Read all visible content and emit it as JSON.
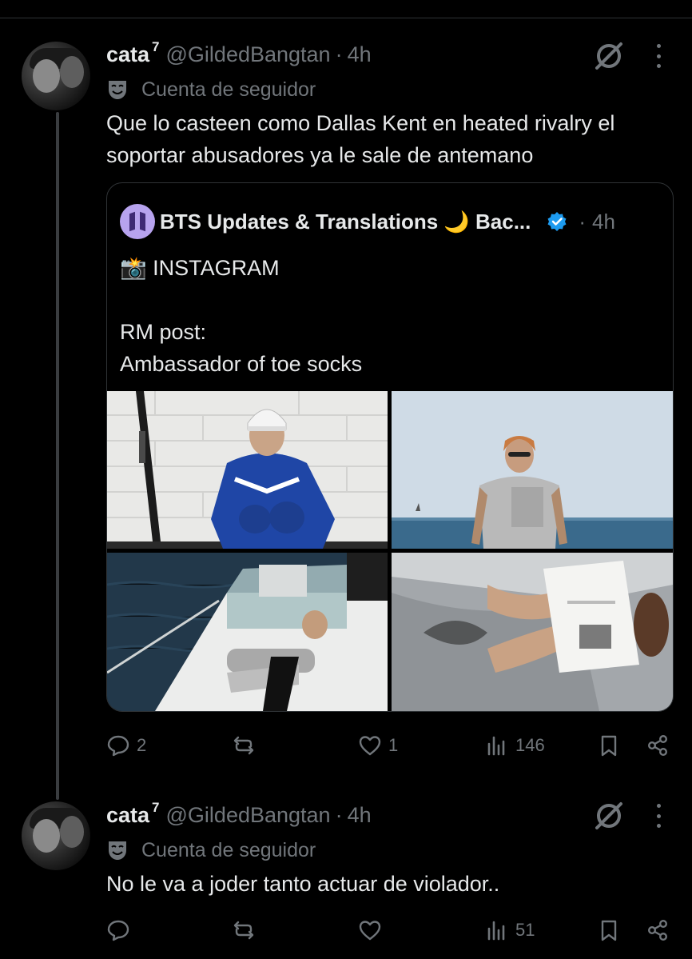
{
  "tweets": [
    {
      "display_name": "cata",
      "name_suffix": "7",
      "handle": "@GildedBangtan",
      "separator": "·",
      "time": "4h",
      "follower_label": "Cuenta de seguidor",
      "text": "Que lo casteen como Dallas Kent en heated rivalry el soportar abusadores ya le sale de antemano",
      "quote": {
        "display_name": "BTS Updates & Translations 🌙 Bac...",
        "separator": "·",
        "time": "4h",
        "text": "📸 INSTAGRAM\n\nRM post:\nAmbassador of toe socks",
        "photos": [
          "hockey-photo",
          "beach-photo",
          "boat-photo",
          "book-photo"
        ]
      },
      "stats": {
        "replies": "2",
        "retweets": "",
        "likes": "1",
        "views": "146"
      }
    },
    {
      "display_name": "cata",
      "name_suffix": "7",
      "handle": "@GildedBangtan",
      "separator": "·",
      "time": "4h",
      "follower_label": "Cuenta de seguidor",
      "text": "No le va a joder tanto actuar de violador..",
      "stats": {
        "replies": "",
        "retweets": "",
        "likes": "",
        "views": "51"
      }
    }
  ],
  "icons": {
    "grok": "grok-icon",
    "more": "more-icon",
    "follower": "theater-mask-icon",
    "verified": "verified-badge-icon",
    "reply": "reply-icon",
    "retweet": "retweet-icon",
    "like": "heart-icon",
    "views": "views-icon",
    "bookmark": "bookmark-icon",
    "share": "share-icon"
  },
  "colors": {
    "background": "#000000",
    "text": "#e7e9ea",
    "muted": "#71767b",
    "verified": "#1d9bf0",
    "border": "#2f3336"
  }
}
